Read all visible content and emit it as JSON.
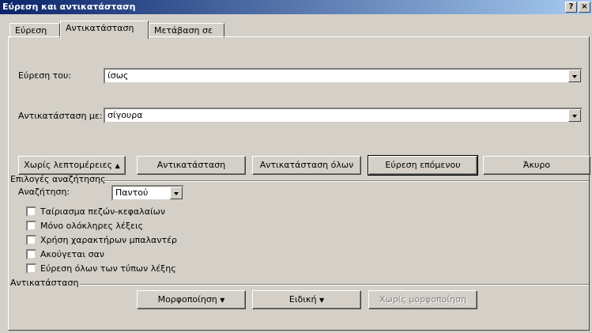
{
  "window": {
    "title": "Εύρεση και αντικατάσταση",
    "help_btn": "?",
    "close_btn": "×"
  },
  "tabs": [
    {
      "label": "Εύρεση",
      "active": false
    },
    {
      "label": "Αντικατάσταση",
      "active": true
    },
    {
      "label": "Μετάβαση σε",
      "active": false
    }
  ],
  "find": {
    "label": "Εύρεση του:",
    "value": "ίσως"
  },
  "replace": {
    "label": "Αντικατάσταση με:",
    "value": "σίγουρα"
  },
  "buttons": {
    "less": "Χωρίς λεπτομέρειες",
    "less_arrow": "▲",
    "replace": "Αντικατάσταση",
    "replace_all": "Αντικατάσταση όλων",
    "find_next": "Εύρεση επόμενου",
    "cancel": "Άκυρο"
  },
  "search_options": {
    "group_label": "Επιλογές αναζήτησης",
    "search_label": "Αναζήτηση:",
    "search_value": "Παντού",
    "checkboxes": [
      {
        "label": "Ταίριασμα πεζών-κεφαλαίων",
        "checked": false
      },
      {
        "label": "Μόνο ολόκληρες λέξεις",
        "checked": false
      },
      {
        "label": "Χρήση χαρακτήρων μπαλαντέρ",
        "checked": false
      },
      {
        "label": "Ακούγεται σαν",
        "checked": false
      },
      {
        "label": "Εύρεση όλων των τύπων λέξης",
        "checked": false
      }
    ]
  },
  "replace_group": {
    "group_label": "Αντικατάσταση",
    "format": "Μορφοποίηση",
    "special": "Ειδική",
    "no_format": "Χωρίς μορφοποίηση",
    "menu_arrow": "▼"
  }
}
